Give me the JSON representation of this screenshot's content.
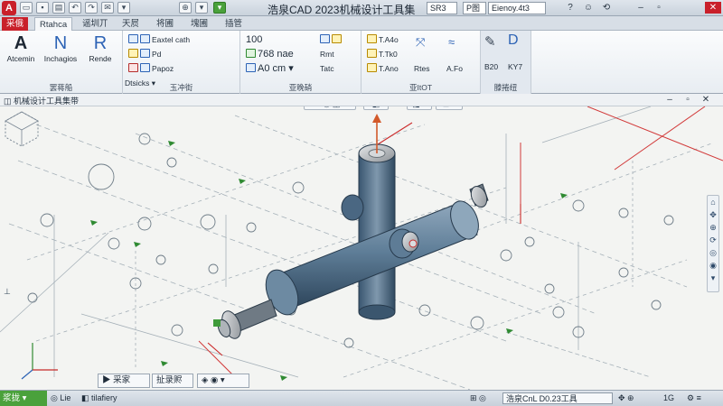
{
  "titlebar": {
    "title": "浩泉CAD 2023机械设计工具集",
    "field_left": "SR3",
    "field_right_prefix": "P图",
    "field_right": "Eienoy.4t3",
    "logo": "A",
    "qat_icons": [
      "folder-icon",
      "save-icon",
      "print-icon",
      "undo-icon",
      "redo-icon",
      "share-icon",
      "dropdown-icon"
    ]
  },
  "tabs": [
    "采俄",
    "Rtahca",
    "谣圳丌",
    "天屃",
    "将圃",
    "塊圃",
    "插管"
  ],
  "ribbon": {
    "group1": {
      "label": "罢蒋船",
      "buttons": [
        {
          "icon": "A",
          "label": "Atcemin"
        },
        {
          "icon": "N",
          "label": "Inchagios"
        },
        {
          "icon": "R",
          "label": "Rende"
        }
      ]
    },
    "group2": {
      "label": "玉冲街",
      "items": [
        "Eaxtel cath",
        "Pd",
        "Papoz",
        "Dtsicks"
      ]
    },
    "group3": {
      "label": "亚晚硝",
      "items": [
        "100",
        "768 nae",
        "A0 cm",
        "Rmt",
        "Tatc"
      ]
    },
    "group4": {
      "label": "亚ItOT",
      "items": [
        "T.A4o",
        "T.Tk0",
        "T.Ano",
        "Rtes",
        "A.Fo"
      ]
    },
    "group5": {
      "label": "滕捲纽",
      "items": [
        "B20",
        "KY7"
      ]
    }
  },
  "document": {
    "title": "机械设计工具集带"
  },
  "command_tabs": [
    "采家",
    "扯录赆"
  ],
  "status": {
    "ready": "浆拢",
    "item1": "Lie",
    "item2": "tilafiery",
    "coords": "浩泉CnL D0.23工具",
    "zoom": "100%",
    "value": "1G"
  },
  "colors": {
    "accent": "#c9202a",
    "ok": "#4aa13b",
    "model": "#5a7a96"
  }
}
